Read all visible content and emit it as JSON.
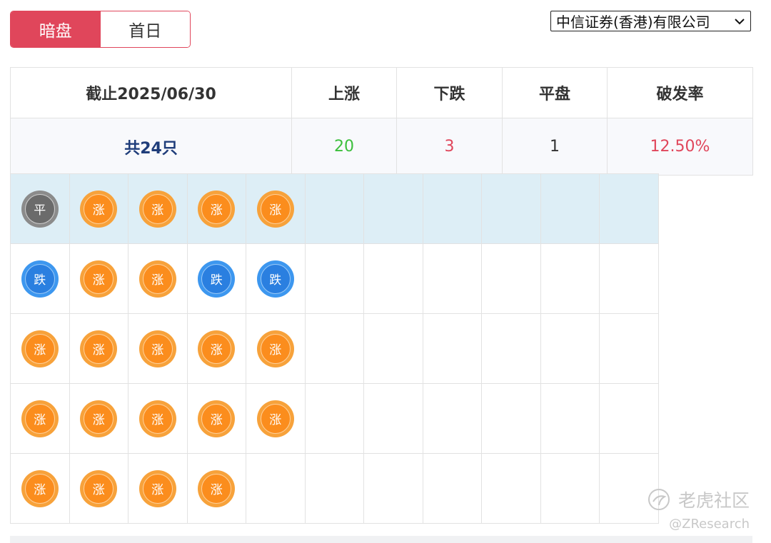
{
  "tabs": [
    {
      "label": "暗盘",
      "active": true
    },
    {
      "label": "首日",
      "active": false
    }
  ],
  "broker_select": {
    "value": "中信证券(香港)有限公司"
  },
  "summary": {
    "headers": {
      "date": "截止2025/06/30",
      "up": "上涨",
      "down": "下跌",
      "flat": "平盘",
      "rate": "破发率"
    },
    "values": {
      "total": "共24只",
      "up": "20",
      "down": "3",
      "flat": "1",
      "rate": "12.50%"
    }
  },
  "grid": {
    "columns": 11,
    "rows": [
      [
        "平",
        "涨",
        "涨",
        "涨",
        "涨"
      ],
      [
        "跌",
        "涨",
        "涨",
        "跌",
        "跌"
      ],
      [
        "涨",
        "涨",
        "涨",
        "涨",
        "涨"
      ],
      [
        "涨",
        "涨",
        "涨",
        "涨",
        "涨"
      ],
      [
        "涨",
        "涨",
        "涨",
        "涨"
      ]
    ]
  },
  "colors": {
    "accent_red": "#e0465b",
    "rise_orange": "#fb8d1d",
    "fall_blue": "#2a7fe0",
    "flat_gray": "#6b6b6b",
    "up_green": "#3cbf3c",
    "highlight_row": "#ddeef6"
  },
  "watermark": {
    "logo_text": "老虎社区",
    "handle": "@ZResearch"
  }
}
